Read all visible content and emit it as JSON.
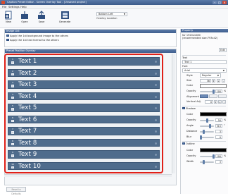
{
  "window": {
    "title": "Caption Preset Editor - Screen Overlay Tool - [Unsaved project]",
    "min": "–",
    "max": "□",
    "close": "×"
  },
  "menu": [
    "File",
    "Settings",
    "Help"
  ],
  "toolbar": {
    "new_label": "New",
    "open_label": "Open",
    "save_label": "Save",
    "generate_label": "Generate",
    "position_value": "Bottom Left",
    "position_caption": "Overlay Location"
  },
  "image_list": {
    "header": "Image List",
    "option1": "Apply the 1st background image to the others",
    "option2": "Apply the 1st text format to the others"
  },
  "preset": {
    "header": "Preset Position Overlay",
    "rows": [
      {
        "num": "1",
        "text": "Text 1"
      },
      {
        "num": "2",
        "text": "Text 2"
      },
      {
        "num": "3",
        "text": "Text 3"
      },
      {
        "num": "4",
        "text": "Text 4"
      },
      {
        "num": "5",
        "text": "Text 5"
      },
      {
        "num": "6",
        "text": "Text 6"
      },
      {
        "num": "7",
        "text": "Text 7"
      },
      {
        "num": "8",
        "text": "Text 8"
      },
      {
        "num": "9",
        "text": "Text 9"
      },
      {
        "num": "10",
        "text": "Text 10"
      }
    ],
    "reset_label": "Reset to Defaults"
  },
  "property": {
    "header": "Property",
    "size_line1": "for 1920x1080",
    "size_line2": "(recommended size:793x42)",
    "browse_label": "Edit",
    "text_label": "Text",
    "text_value": "Text 1",
    "font_label": "Font",
    "font_value": "Arial",
    "style_label": "Style",
    "style_value": "Regular",
    "size_label": "Size",
    "size_value": "36",
    "color_label": "Color",
    "opacity_label": "Opacity",
    "opacity_value": "100",
    "alignment_label": "Alignment",
    "valign_label": "Vertical Adj.",
    "valign_value": "0",
    "shadow_label": "Shadow",
    "sh_color_label": "Color",
    "sh_opacity_label": "Opacity",
    "sh_opacity_value": "50",
    "sh_angle_label": "Angle",
    "sh_angle_value": "315",
    "sh_distance_label": "Distance",
    "sh_distance_value": "3",
    "sh_blur_label": "Blur",
    "sh_blur_value": "0",
    "outline_label": "Outline",
    "ol_color_label": "Color",
    "ol_opacity_label": "Opacity",
    "ol_opacity_value": "100",
    "ol_width_label": "Width",
    "ol_width_value": "3",
    "pct": "%",
    "deg": "°"
  }
}
